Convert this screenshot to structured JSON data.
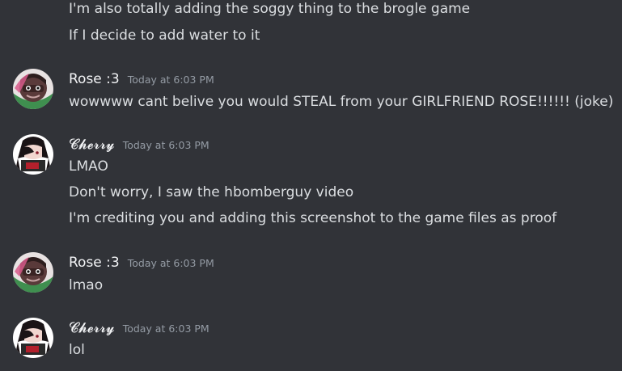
{
  "messages": [
    {
      "continuation": true,
      "lines": [
        "I'm also totally adding the soggy thing to the brogle game",
        "If I decide to add water to it"
      ]
    },
    {
      "author": "Rose :3",
      "timestamp": "Today at 6:03 PM",
      "avatar_icon": "rose-avatar-icon",
      "lines": [
        "wowwww cant belive you would STEAL from your GIRLFRIEND ROSE!!!!!! (joke)"
      ]
    },
    {
      "author": "𝓒𝓱𝓮𝓻𝓻𝔂",
      "timestamp": "Today at 6:03 PM",
      "avatar_icon": "cherry-avatar-icon",
      "lines": [
        "LMAO",
        "Don't worry, I saw the hbomberguy video",
        "I'm crediting you and adding this screenshot to the game files as proof"
      ]
    },
    {
      "author": "Rose :3",
      "timestamp": "Today at 6:03 PM",
      "avatar_icon": "rose-avatar-icon",
      "lines": [
        "lmao"
      ]
    },
    {
      "author": "𝓒𝓱𝓮𝓻𝓻𝔂",
      "timestamp": "Today at 6:03 PM",
      "avatar_icon": "cherry-avatar-icon",
      "lines": [
        "lol"
      ]
    }
  ],
  "colors": {
    "background": "#313338",
    "message_text": "#dbdee1",
    "username": "#f2f3f5",
    "timestamp": "#949ba4"
  }
}
